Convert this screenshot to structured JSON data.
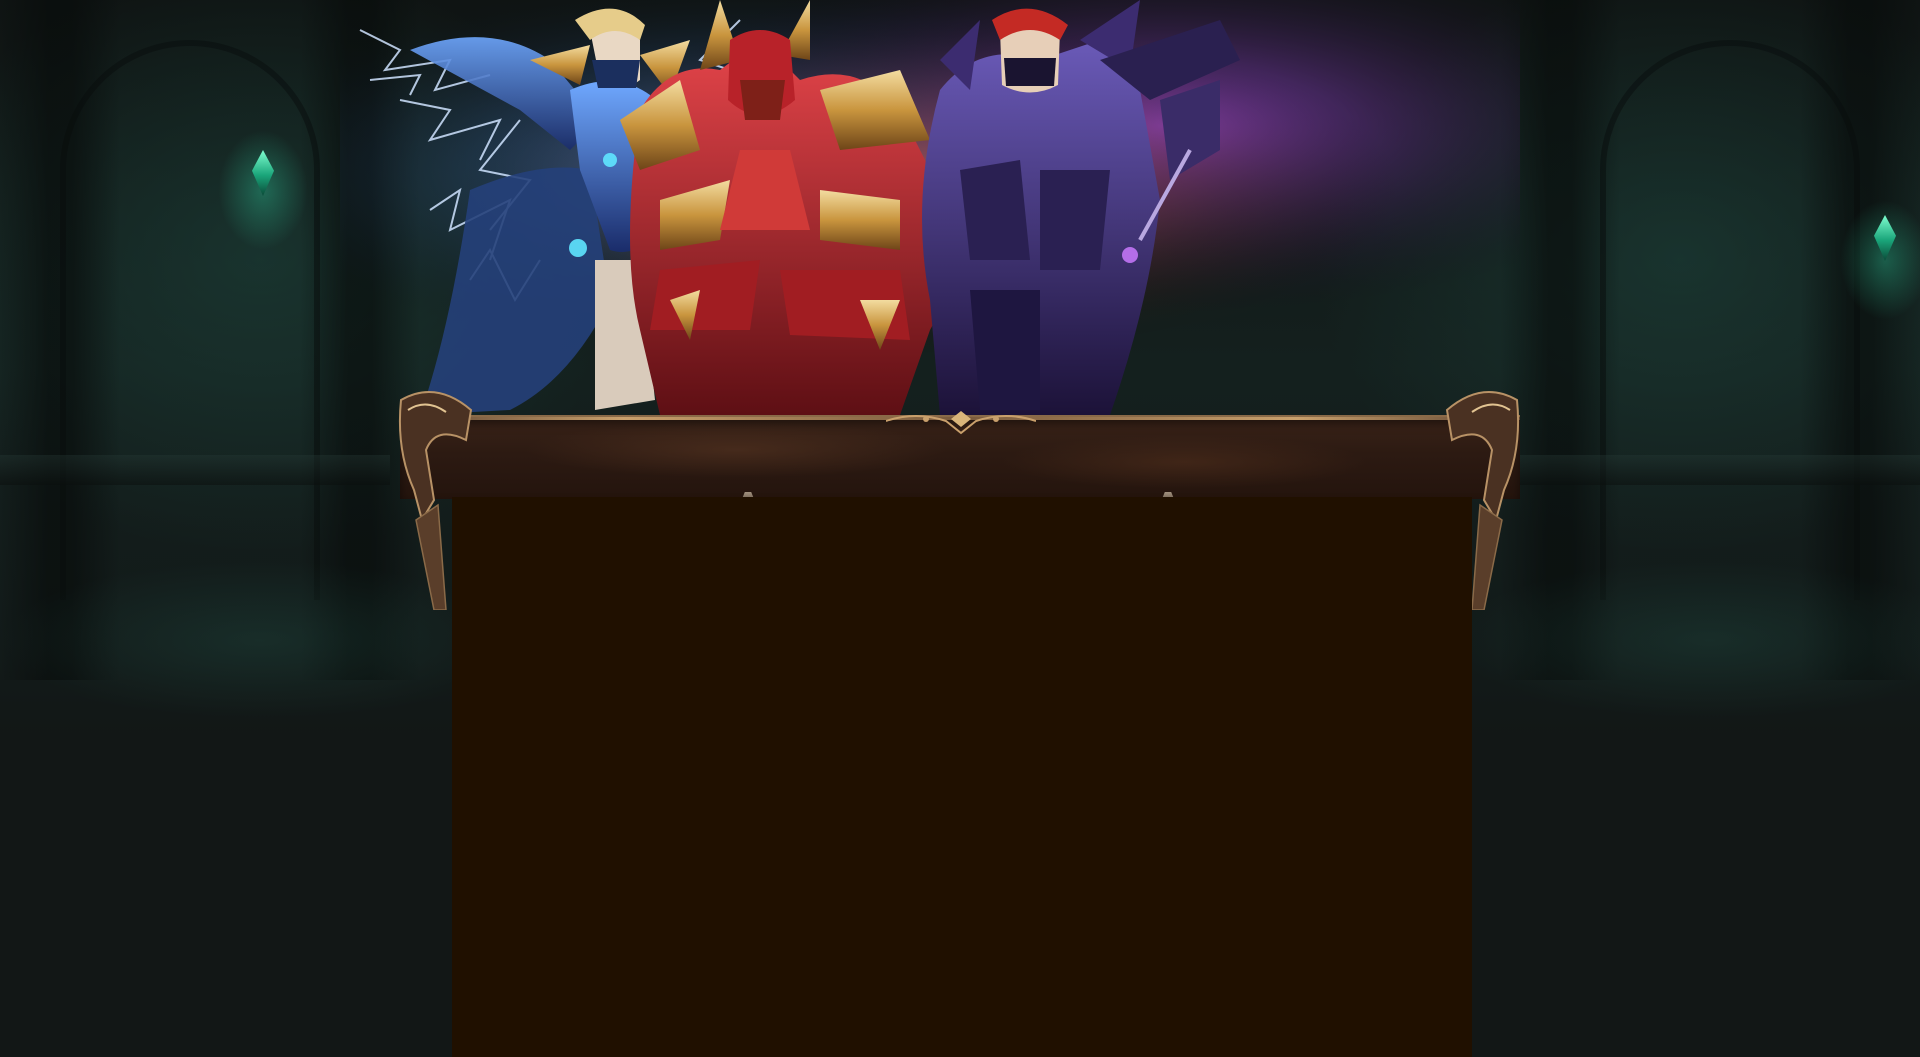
{
  "page": {
    "background_color": "#121716",
    "panel_color": "#201000",
    "accent_gem_color": "#2bd9a0",
    "frame_trim_color": "#c9a06c"
  },
  "hero": {
    "characters": [
      "lightning-mage",
      "dragon-knight",
      "dark-assassin"
    ],
    "lightning_color": "#9cc8ff",
    "dragon_armor_color": "#c8282e",
    "assassin_aura_color": "#7a3fb5"
  },
  "icons": {
    "left_gem": "green-gem-icon",
    "right_gem": "green-gem-icon",
    "frame_ornament": "filigree-ornament-icon"
  }
}
